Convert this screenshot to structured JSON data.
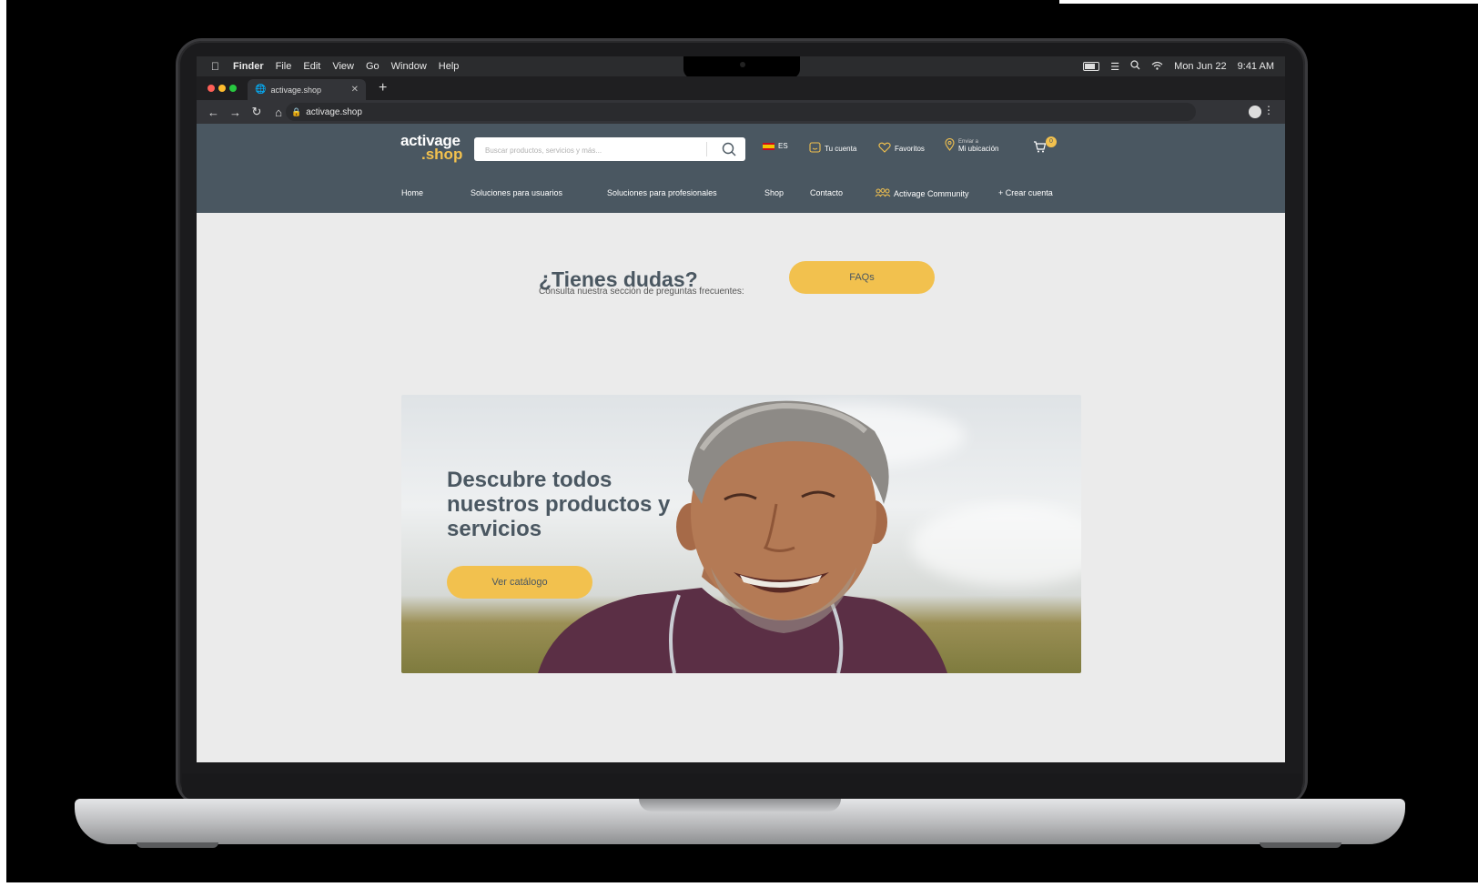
{
  "menubar": {
    "items": [
      "Finder",
      "File",
      "Edit",
      "View",
      "Go",
      "Window",
      "Help"
    ],
    "date": "Mon Jun 22",
    "time": "9:41 AM"
  },
  "browser": {
    "tab_title": "activage.shop",
    "url": "activage.shop"
  },
  "header": {
    "logo_line1": "activage",
    "logo_line2": ".shop",
    "search_placeholder": "Buscar productos, servicios y más...",
    "language": "ES",
    "account": "Tu cuenta",
    "favorites": "Favoritos",
    "location_small": "Enviar a",
    "location": "Mi ubicación",
    "cart_count": "0"
  },
  "nav": {
    "items": [
      "Home",
      "Soluciones para usuarios",
      "Soluciones para profesionales",
      "Shop",
      "Contacto",
      "Activage Community",
      "+ Crear cuenta"
    ]
  },
  "faq": {
    "title": "¿Tienes dudas?",
    "subtitle": "Consulta nuestra sección de preguntas frecuentes:",
    "button": "FAQs"
  },
  "hero": {
    "title": "Descubre todos nuestros productos y servicios",
    "button": "Ver catálogo"
  },
  "colors": {
    "header_bg": "#4a5761",
    "accent": "#f2c14e",
    "page_bg": "#ebebeb"
  }
}
